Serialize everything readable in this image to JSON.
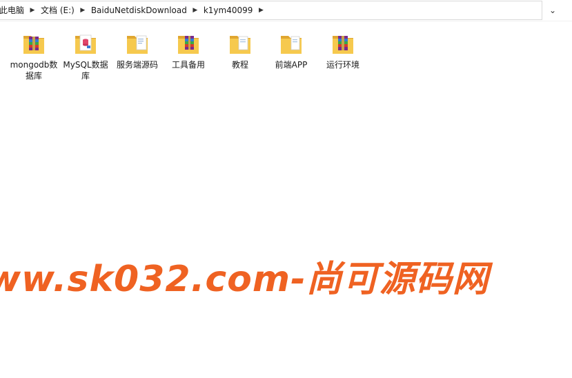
{
  "breadcrumb": {
    "items": [
      "此电脑",
      "文档 (E:)",
      "BaiduNetdiskDownload",
      "k1ym40099"
    ]
  },
  "folders": [
    {
      "name": "mongodb数据库",
      "overlay": "winrar-archive-icon"
    },
    {
      "name": "MySQL数据库",
      "overlay": "mysql-document-icon"
    },
    {
      "name": "服务端源码",
      "overlay": "document-icon"
    },
    {
      "name": "工具备用",
      "overlay": "winrar-archive-icon"
    },
    {
      "name": "教程",
      "overlay": "document-icon"
    },
    {
      "name": "前端APP",
      "overlay": "document-icon"
    },
    {
      "name": "运行环境",
      "overlay": "winrar-archive-icon"
    }
  ],
  "watermark": {
    "text": "ww.sk032.com-尚可源码网",
    "color": "#ef6222"
  },
  "colors": {
    "folder": "#f6c94e",
    "folder_dark": "#e0a630"
  }
}
